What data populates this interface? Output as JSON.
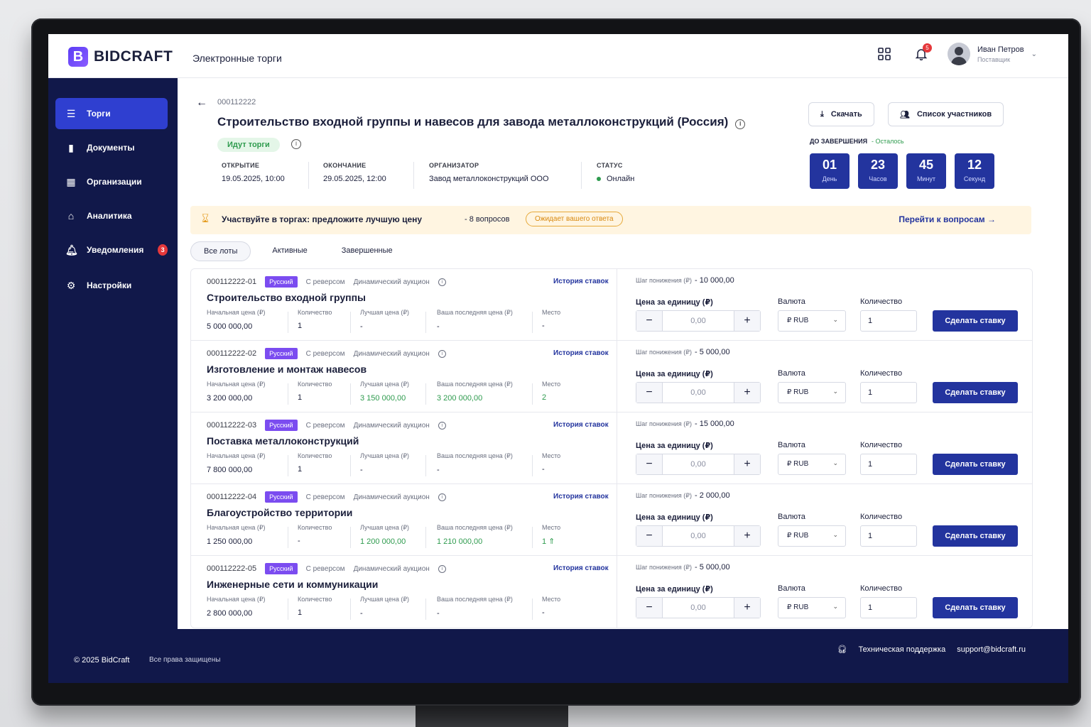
{
  "header": {
    "brand": "BIDCRAFT",
    "brand_mark": "B",
    "subtitle": "Электронные торги",
    "notifications_count": "5",
    "user_name": "Иван Петров",
    "user_role": "Поставщик"
  },
  "sidebar": {
    "items": [
      {
        "label": "Торги",
        "icon": "list-icon",
        "active": true
      },
      {
        "label": "Документы",
        "icon": "document-icon"
      },
      {
        "label": "Организации",
        "icon": "building-icon"
      },
      {
        "label": "Аналитика",
        "icon": "bank-icon"
      },
      {
        "label": "Уведомления",
        "icon": "bell-icon",
        "badge": "3"
      },
      {
        "label": "Настройки",
        "icon": "gear-icon"
      }
    ]
  },
  "tender": {
    "id": "000112222",
    "title": "Строительство входной группы и навесов для завода металлоконструкций (Россия)",
    "status_chip": "Идут торги",
    "meta": [
      {
        "label": "ОТКРЫТИЕ",
        "value": "19.05.2025, 10:00"
      },
      {
        "label": "ОКОНЧАНИЕ",
        "value": "29.05.2025, 12:00"
      },
      {
        "label": "ОРГАНИЗАТОР",
        "value": "Завод металлоконструкций ООО"
      },
      {
        "label": "СТАТУС",
        "value": "Онлайн"
      }
    ],
    "download_label": "Скачать",
    "participants_label": "Список участников",
    "countdown_label": "ДО ЗАВЕРШЕНИЯ",
    "countdown_remaining": "- Осталось",
    "countdown": [
      {
        "num": "01",
        "unit": "День"
      },
      {
        "num": "23",
        "unit": "Часов"
      },
      {
        "num": "45",
        "unit": "Минут"
      },
      {
        "num": "12",
        "unit": "Секунд"
      }
    ]
  },
  "banner": {
    "text": "Участвуйте в торгах: предложите лучшую цену",
    "count": "- 8 вопросов",
    "chip": "Ожидает вашего ответа",
    "link": "Перейти к вопросам"
  },
  "tabs": [
    "Все лоты",
    "Активные",
    "Завершенные"
  ],
  "lot_labels": {
    "lang": "Русский",
    "reverse": "С реверсом",
    "auction": "Динамический аукцион",
    "history": "История ставок",
    "start_price": "Начальная цена (₽)",
    "quantity": "Количество",
    "best_price": "Лучшая цена (₽)",
    "last_bid": "Ваша последняя цена (₽)",
    "place": "Место",
    "step": "Шаг понижения (₽)",
    "unit_price": "Цена за единицу (₽)",
    "currency": "Валюта",
    "qty_label": "Количество",
    "price_placeholder": "0,00",
    "currency_value": "₽ RUB",
    "bid_button": "Сделать ставку"
  },
  "lots": [
    {
      "code": "000112222-01",
      "name": "Строительство входной группы",
      "start": "5 000 000,00",
      "qty": "1",
      "best": "-",
      "last": "-",
      "place": "-",
      "step": "- 10 000,00",
      "qty_input": "1",
      "green": false
    },
    {
      "code": "000112222-02",
      "name": "Изготовление и монтаж навесов",
      "start": "3 200 000,00",
      "qty": "1",
      "best": "3 150 000,00",
      "last": "3 200 000,00",
      "place": "2",
      "step": "- 5 000,00",
      "qty_input": "1",
      "green": true
    },
    {
      "code": "000112222-03",
      "name": "Поставка металлоконструкций",
      "start": "7 800 000,00",
      "qty": "1",
      "best": "-",
      "last": "-",
      "place": "-",
      "step": "- 15 000,00",
      "qty_input": "1",
      "green": false
    },
    {
      "code": "000112222-04",
      "name": "Благоустройство территории",
      "start": "1 250 000,00",
      "qty": "-",
      "best": "1 200 000,00",
      "last": "1 210 000,00",
      "place": "1 ⇑",
      "step": "- 2 000,00",
      "qty_input": "1",
      "green": true
    },
    {
      "code": "000112222-05",
      "name": "Инженерные сети и коммуникации",
      "start": "2 800 000,00",
      "qty": "1",
      "best": "-",
      "last": "-",
      "place": "-",
      "step": "- 5 000,00",
      "qty_input": "1",
      "green": false
    }
  ],
  "footer": {
    "copyright": "© 2025 BidCraft",
    "rights": "Все права защищены",
    "support_label": "Техническая поддержка",
    "support_email": "support@bidcraft.ru"
  },
  "colors": {
    "accent": "#23349e",
    "sidebar": "#11184a",
    "active_nav": "#2f3fd0",
    "success": "#2e9b4e",
    "lang_badge": "#7b4cf0"
  }
}
